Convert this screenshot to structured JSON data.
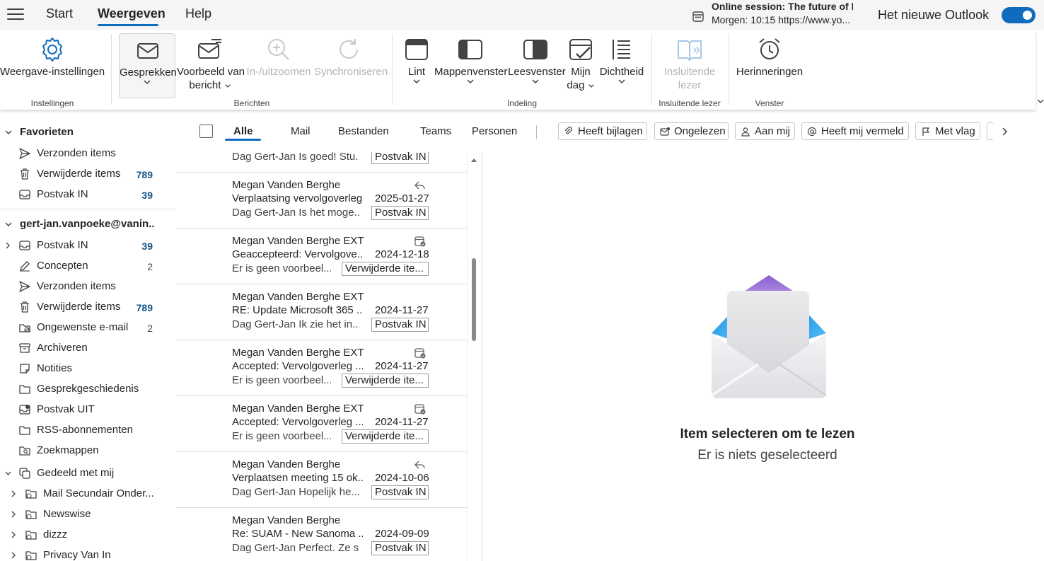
{
  "topbar": {
    "menu": {
      "start": "Start",
      "view": "Weergeven",
      "help": "Help"
    },
    "session": {
      "title": "Online session: The future of l...",
      "time": "Morgen: 10:15 https://www.yo..."
    },
    "new_outlook": {
      "label": "Het nieuwe Outlook",
      "enabled": true
    }
  },
  "ribbon": {
    "settings": {
      "label": "Weergave-instellingen",
      "group": "Instellingen"
    },
    "messages": {
      "group": "Berichten",
      "conversations": "Gesprekken",
      "preview_line1": "Voorbeeld van",
      "preview_line2": "bericht",
      "zoom": "In-/uitzoomen",
      "sync": "Synchroniseren"
    },
    "layout": {
      "group": "Indeling",
      "ribbon": "Lint",
      "folder_pane": "Mappenvenster",
      "reading_pane": "Leesvenster",
      "my_day_line1": "Mijn",
      "my_day_line2": "dag",
      "density": "Dichtheid"
    },
    "immersive": {
      "group": "Insluitende lezer",
      "line1": "Insluitende",
      "line2": "lezer"
    },
    "window": {
      "group": "Venster",
      "reminders": "Herinneringen"
    }
  },
  "sidebar": {
    "favorites": {
      "title": "Favorieten",
      "items": [
        {
          "label": "Verzonden items",
          "icon": "send-icon",
          "count": ""
        },
        {
          "label": "Verwijderde items",
          "icon": "trash-icon",
          "count": "789"
        },
        {
          "label": "Postvak IN",
          "icon": "inbox-icon",
          "count": "39"
        }
      ]
    },
    "account": {
      "title": "gert-jan.vanpoeke@vanin....",
      "items": [
        {
          "label": "Postvak IN",
          "icon": "inbox-icon",
          "count": "39"
        },
        {
          "label": "Concepten",
          "icon": "draft-icon",
          "count": "2"
        },
        {
          "label": "Verzonden items",
          "icon": "send-icon",
          "count": ""
        },
        {
          "label": "Verwijderde items",
          "icon": "trash-icon",
          "count": "789"
        },
        {
          "label": "Ongewenste e-mail",
          "icon": "junk-icon",
          "count": "2"
        },
        {
          "label": "Archiveren",
          "icon": "archive-icon",
          "count": ""
        },
        {
          "label": "Notities",
          "icon": "note-icon",
          "count": ""
        },
        {
          "label": "Gesprekgeschiedenis",
          "icon": "folder-icon",
          "count": ""
        },
        {
          "label": "Postvak UIT",
          "icon": "outbox-icon",
          "count": ""
        },
        {
          "label": "RSS-abonnementen",
          "icon": "folder-icon",
          "count": ""
        },
        {
          "label": "Zoekmappen",
          "icon": "search-folder-icon",
          "count": ""
        }
      ]
    },
    "shared": {
      "title": "Gedeeld met mij",
      "items": [
        {
          "label": "Mail Secundair Onder..."
        },
        {
          "label": "Newswise"
        },
        {
          "label": "dizzz"
        },
        {
          "label": "Privacy Van In"
        }
      ]
    }
  },
  "filters": {
    "tabs": {
      "all": "Alle",
      "mail": "Mail",
      "files": "Bestanden",
      "teams": "Teams",
      "people": "Personen"
    },
    "chips": {
      "attachments": "Heeft bijlagen",
      "unread": "Ongelezen",
      "to_me": "Aan mij",
      "mentions": "Heeft mij vermeld",
      "flagged": "Met vlag"
    }
  },
  "messages": {
    "partial": {
      "preview": "Dag Gert-Jan Is goed! Stu...",
      "folder": "Postvak IN"
    },
    "rows": [
      {
        "sender": "Megan Vanden Berghe",
        "subject": "Verplaatsing vervolgoverleg",
        "preview": "Dag Gert-Jan Is het moge...",
        "date": "2025-01-27",
        "folder": "Postvak IN",
        "icon": "reply-icon"
      },
      {
        "sender": "Megan Vanden Berghe EXT",
        "subject": "Geaccepteerd: Vervolgove...",
        "preview": "Er is geen voorbeel...",
        "date": "2024-12-18",
        "folder": "Verwijderde ite...",
        "icon": "calendar-accepted-icon"
      },
      {
        "sender": "Megan Vanden Berghe EXT",
        "subject": "RE: Update Microsoft 365 ...",
        "preview": "Dag Gert-Jan Ik zie het in...",
        "date": "2024-11-27",
        "folder": "Postvak IN",
        "icon": ""
      },
      {
        "sender": "Megan Vanden Berghe EXT",
        "subject": "Accepted: Vervolgoverleg ...",
        "preview": "Er is geen voorbeel...",
        "date": "2024-11-27",
        "folder": "Verwijderde ite...",
        "icon": "calendar-accepted-icon"
      },
      {
        "sender": "Megan Vanden Berghe EXT",
        "subject": "Accepted: Vervolgoverleg ...",
        "preview": "Er is geen voorbeel...",
        "date": "2024-11-27",
        "folder": "Verwijderde ite...",
        "icon": "calendar-accepted-icon"
      },
      {
        "sender": "Megan Vanden Berghe",
        "subject": "Verplaatsen meeting 15 ok...",
        "preview": "Dag Gert-Jan Hopelijk he...",
        "date": "2024-10-06",
        "folder": "Postvak IN",
        "icon": "reply-icon"
      },
      {
        "sender": "Megan Vanden Berghe",
        "subject": "Re: SUAM - New Sanoma ...",
        "preview": "Dag Gert-Jan Perfect. Ze s...",
        "date": "2024-09-09",
        "folder": "Postvak IN",
        "icon": ""
      }
    ]
  },
  "reading_pane": {
    "title": "Item selecteren om te lezen",
    "subtitle": "Er is niets geselecteerd"
  },
  "colors": {
    "accent": "#0f6cbd",
    "count": "#0f548c",
    "topbar_bg": "#f5f5f5"
  }
}
